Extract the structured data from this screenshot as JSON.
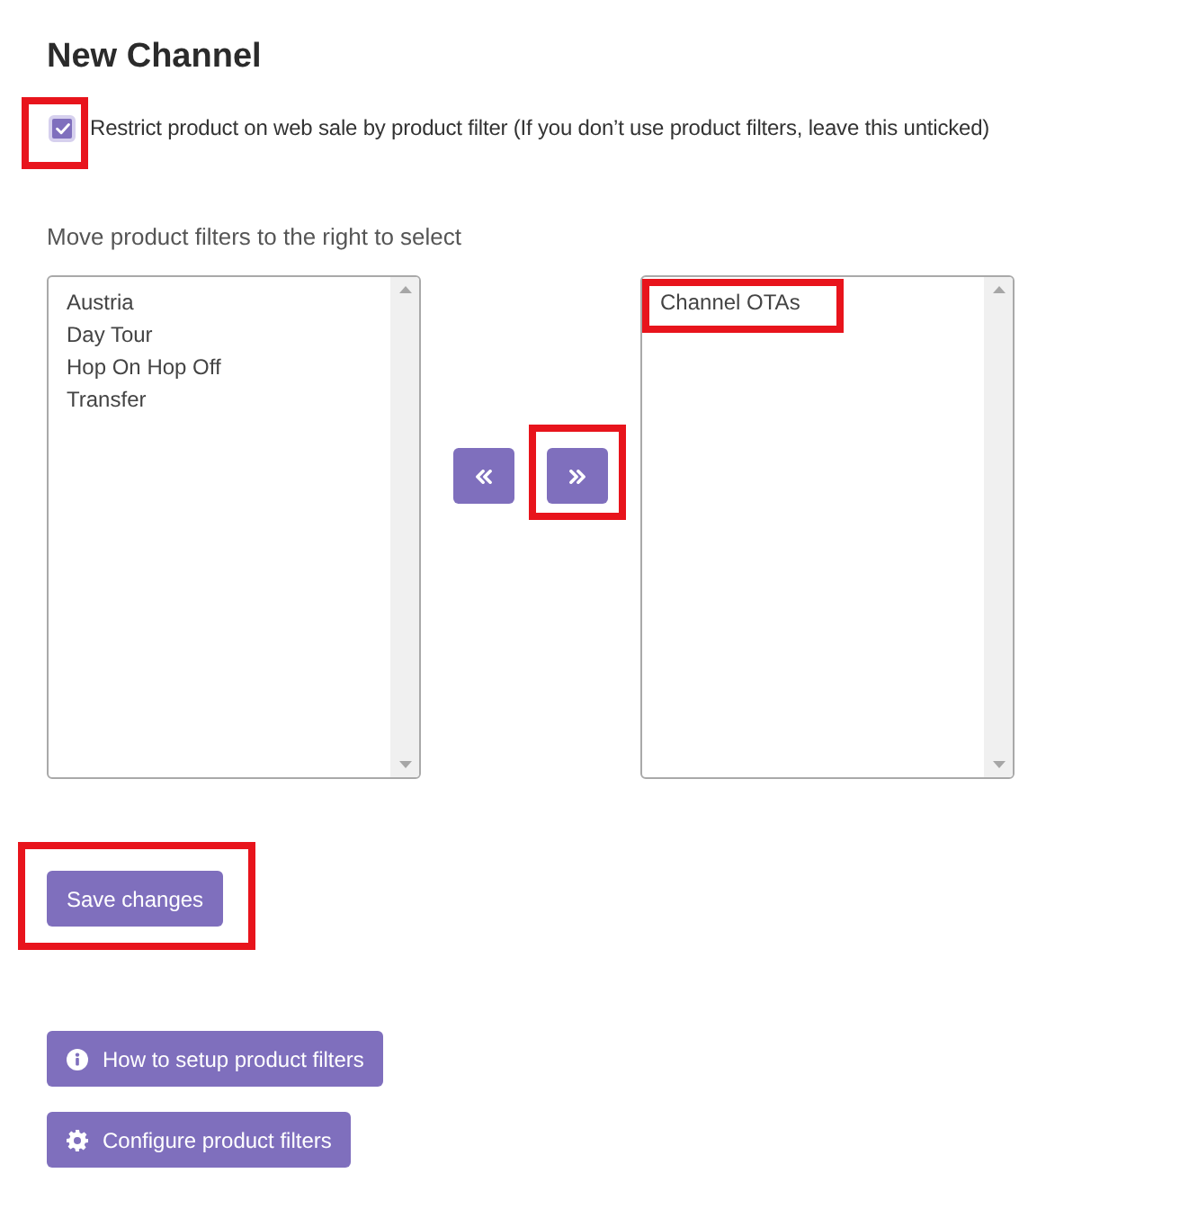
{
  "page": {
    "title": "New Channel"
  },
  "restrict": {
    "label": "Restrict product on web sale by product filter (If you don’t use product filters, leave this unticked)",
    "checked": true,
    "highlighted": true
  },
  "picker": {
    "instruction": "Move product filters to the right to select",
    "available": [
      {
        "label": "Austria",
        "selected": false
      },
      {
        "label": "Day Tour",
        "selected": false
      },
      {
        "label": "Hop On Hop Off",
        "selected": false
      },
      {
        "label": "Transfer",
        "selected": false
      }
    ],
    "move_buttons": [
      {
        "kind": "left",
        "highlighted": false
      },
      {
        "kind": "right",
        "highlighted": true
      }
    ],
    "chosen": [
      {
        "label": "Channel OTAs",
        "selected": false,
        "highlighted": true
      }
    ]
  },
  "actions": [
    {
      "label": "Save changes",
      "kind": "primary",
      "highlighted": true
    }
  ],
  "help_buttons": [
    {
      "label": "How to setup product filters",
      "kind": "info"
    },
    {
      "label": "Configure product filters",
      "kind": "settings"
    }
  ]
}
